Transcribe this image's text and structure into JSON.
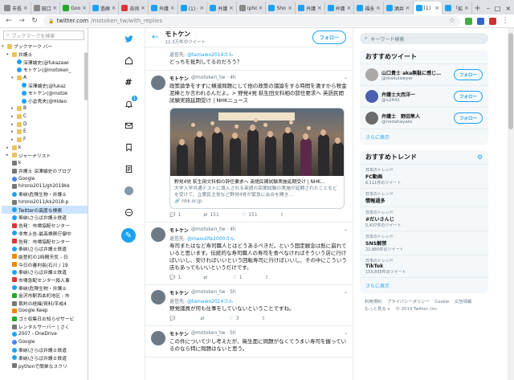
{
  "browser": {
    "tabs": [
      {
        "label": "市長の",
        "icon": "grey"
      },
      {
        "label": "田口日",
        "icon": "grey"
      },
      {
        "label": "Googl",
        "icon": "google"
      },
      {
        "label": "過疎",
        "icon": "tw"
      },
      {
        "label": "奈良",
        "icon": "red"
      },
      {
        "label": "弁護士",
        "icon": "tw"
      },
      {
        "label": "(1) 奈",
        "icon": "tw"
      },
      {
        "label": "弁護",
        "icon": "tw"
      },
      {
        "label": "iphon",
        "icon": "grey"
      },
      {
        "label": "Shoku",
        "icon": "tw"
      },
      {
        "label": "弁護士",
        "icon": "tw"
      },
      {
        "label": "弁護士",
        "icon": "tw"
      },
      {
        "label": "福永",
        "icon": "tw"
      },
      {
        "label": "酒井",
        "icon": "tw"
      },
      {
        "label": "(1)",
        "icon": "tw"
      },
      {
        "label": "「拡散",
        "icon": "tw"
      }
    ],
    "active_tab_index": 14,
    "url_host": "twitter.com",
    "url_path": "/motoken_tw/with_replies"
  },
  "bookmarks": {
    "search_placeholder": "ブックマークを検索",
    "items": [
      {
        "label": "ブックマーク バー",
        "icon": "folder",
        "arrow": "▾",
        "indent": 0
      },
      {
        "label": "弁護士",
        "icon": "folder",
        "arrow": "▾",
        "indent": 1
      },
      {
        "label": "深澤諭史(@fukazawi",
        "icon": "tw",
        "arrow": "",
        "indent": 2
      },
      {
        "label": "モトケン(@motoken_",
        "icon": "tw",
        "arrow": "",
        "indent": 2
      },
      {
        "label": "A",
        "icon": "folder",
        "arrow": "▾",
        "indent": 2
      },
      {
        "label": "深澤諭史(@fukaz",
        "icon": "tw",
        "arrow": "",
        "indent": 3
      },
      {
        "label": "モトケン(@motok",
        "icon": "tw",
        "arrow": "",
        "indent": 3
      },
      {
        "label": "小倉秀夫(@Hideo",
        "icon": "tw",
        "arrow": "",
        "indent": 3
      },
      {
        "label": "B",
        "icon": "folder",
        "arrow": "▸",
        "indent": 2
      },
      {
        "label": "C",
        "icon": "folder",
        "arrow": "▸",
        "indent": 2
      },
      {
        "label": "D",
        "icon": "folder",
        "arrow": "▸",
        "indent": 2
      },
      {
        "label": "E",
        "icon": "folder",
        "arrow": "▸",
        "indent": 2
      },
      {
        "label": "F",
        "icon": "folder",
        "arrow": "▸",
        "indent": 2
      },
      {
        "label": "k",
        "icon": "folder",
        "arrow": "▸",
        "indent": 1
      },
      {
        "label": "ジャーナリスト",
        "icon": "folder",
        "arrow": "▸",
        "indent": 1
      },
      {
        "label": "k",
        "icon": "gen",
        "arrow": "",
        "indent": 1
      },
      {
        "label": "弁護士 深澤諭史のブログ",
        "icon": "gen",
        "arrow": "",
        "indent": 1
      },
      {
        "label": "Google",
        "icon": "google",
        "arrow": "",
        "indent": 1
      },
      {
        "label": "hirono2011/gh2019kk",
        "icon": "gen",
        "arrow": "",
        "indent": 1
      },
      {
        "label": "奉納\\危険生物・弁護士",
        "icon": "tw",
        "arrow": "",
        "indent": 1
      },
      {
        "label": "hirono2011/kk2018-p",
        "icon": "gen",
        "arrow": "",
        "indent": 1
      },
      {
        "label": "Twitterの高度な検索",
        "icon": "tw",
        "arrow": "",
        "indent": 1
      },
      {
        "label": "奉納\\さらば弁護士鉄道",
        "icon": "tw",
        "arrow": "",
        "indent": 1
      },
      {
        "label": "告発：市場協配センター",
        "icon": "red",
        "arrow": "",
        "indent": 1
      },
      {
        "label": "非常上告-最高検察庁御中",
        "icon": "tw",
        "arrow": "",
        "indent": 1
      },
      {
        "label": "告発：市場協配センター",
        "icon": "red",
        "arrow": "",
        "indent": 1
      },
      {
        "label": "奉納\\さらば弁護士鉄道",
        "icon": "tw",
        "arrow": "",
        "indent": 1
      },
      {
        "label": "能登町の1時間天気 - 日",
        "icon": "orange",
        "arrow": "",
        "indent": 1
      },
      {
        "label": "今日の審判長(石川 / 19",
        "icon": "orange",
        "arrow": "",
        "indent": 1
      },
      {
        "label": "奉納\\さらば弁護士鉄道",
        "icon": "tw",
        "arrow": "",
        "indent": 1
      },
      {
        "label": "市場急配センター殺人事",
        "icon": "red",
        "arrow": "",
        "indent": 1
      },
      {
        "label": "奉納\\危険生物・弁護士",
        "icon": "tw",
        "arrow": "",
        "indent": 1
      },
      {
        "label": "金沢市駅西本町地区 : 市",
        "icon": "green",
        "arrow": "",
        "indent": 1
      },
      {
        "label": "裁判の経緯/資料/平成4",
        "icon": "gen",
        "arrow": "",
        "indent": 1
      },
      {
        "label": "Google Keep",
        "icon": "orange",
        "arrow": "",
        "indent": 1
      },
      {
        "label": "ゴミ収集日お知らせサービ",
        "icon": "green",
        "arrow": "",
        "indent": 1
      },
      {
        "label": "レンタルサーバー | さく",
        "icon": "gen",
        "arrow": "",
        "indent": 1
      },
      {
        "label": "2007 - OneDrive",
        "icon": "tw",
        "arrow": "",
        "indent": 1
      },
      {
        "label": "Google",
        "icon": "google",
        "arrow": "",
        "indent": 1
      },
      {
        "label": "奉納\\さらば弁護士鉄道",
        "icon": "tw",
        "arrow": "",
        "indent": 1
      },
      {
        "label": "奉納\\さらば弁護士鉄道",
        "icon": "tw",
        "arrow": "",
        "indent": 1
      },
      {
        "label": "pythonで簡単なスクリ",
        "icon": "gen",
        "arrow": "",
        "indent": 1
      }
    ],
    "selected_index": 21
  },
  "nav": {
    "icons": [
      "home-icon",
      "explore-icon",
      "hashtag-icon",
      "notifications-icon",
      "messages-icon",
      "bookmarks-icon",
      "lists-icon",
      "profile-icon",
      "more-icon"
    ],
    "notification_count": "1",
    "tweet_button": "+"
  },
  "header": {
    "name": "モトケン",
    "tweet_count": "12.3万件のツイート",
    "follow_label": "フォロー"
  },
  "tweets": [
    {
      "partial_top": true,
      "reply_to_prefix": "返信先: ",
      "reply_to": "@tamawo2014さん",
      "text": "どっちを批判してるのだろう？"
    },
    {
      "name": "モトケン",
      "handle": "@motoken_tw · 4h",
      "text": "政策論争をすずに横道問題にして他の政策の議論をする時間を潰すから税金泥棒とか言われるんだよ。> 野党4党 萩生田文科相の辞任要求へ 英語民間試験実施延期受け | NHKニュース",
      "card_title": "野党4党 萩生田文科相の辞任要求へ 英語民間試験実施延期受け | NHK…",
      "card_desc": "大学入学共通テストに導入される英語の民間試験の実施が延期されたことなどを受けて、立憲民主党など野党4党が緊急に会合を開き…",
      "card_domain": "nhk.or.jp",
      "replies": "1",
      "retweets": "151",
      "likes": "151"
    },
    {
      "name": "モトケン",
      "handle": "@motoken_tw · 4h",
      "reply_to_prefix": "返信先: ",
      "reply_to": "@maoulife2000さん",
      "text": "寿司またはなど寿司職人とはどうあるべきだ。という固定観念は既に崩れていると思います。伝統的な寿司職人の寿司を食べなければそういう店に行けばいいし、安ければいいという回転寿司に行けばいいし、その中にこういう店もあってもいいというだけです。",
      "replies": "1",
      "retweets": "",
      "likes": "1"
    },
    {
      "name": "モトケン",
      "handle": "@motoken_tw · 5h",
      "reply_to_prefix": "返信先: ",
      "reply_to": "@tamawo2014さん",
      "text": "野党議員が何も仕事をしていないということですね。",
      "replies": "",
      "retweets": "",
      "likes": "3"
    },
    {
      "name": "モトケン",
      "handle": "@motoken_tw · 5h",
      "text": "この件について少し考えたが、衛生面に問題がなくてうまい寿司を握っているのなら特に問題はないと思う。"
    }
  ],
  "right": {
    "search_placeholder": "キーワード検索",
    "who_title": "おすすめツイート",
    "who": [
      {
        "name": "山口貴士 aka無駄に感じ…",
        "handle": "@otakulawyer",
        "button": "フォロー"
      },
      {
        "name": "弁護士大西洋一",
        "handle": "@o2441",
        "button": "フォロー"
      },
      {
        "name": "弁護士　野田隼人",
        "handle": "@nodahayato",
        "button": "フォロー"
      }
    ],
    "who_more": "さらに表示",
    "trends_title": "おすすめトレンド",
    "trends": [
      {
        "label": "日本のトレンド",
        "name": "FC動画",
        "count": "6,111件のツイート"
      },
      {
        "label": "日本のトレンド",
        "name": "情報過多",
        "count": ""
      },
      {
        "label": "日本のトレンド",
        "name": "#だいさんじ",
        "count": "5,437件のツイート"
      },
      {
        "label": "日本のトレンド",
        "name": "SNS解禁",
        "count": "22,880件のツイート"
      },
      {
        "label": "日本のトレンド",
        "name": "TikTok",
        "count": "155,835件のツイート"
      }
    ],
    "trends_more": "さらに表示",
    "footer_links": [
      "利用規約",
      "プライバシーポリシー",
      "Cookie",
      "広告情報",
      "もっと見る ∨",
      "© 2019 Twitter, Inc."
    ]
  },
  "colors": {
    "accent": "#1da1f2",
    "text": "#14171a",
    "muted": "#657786"
  }
}
